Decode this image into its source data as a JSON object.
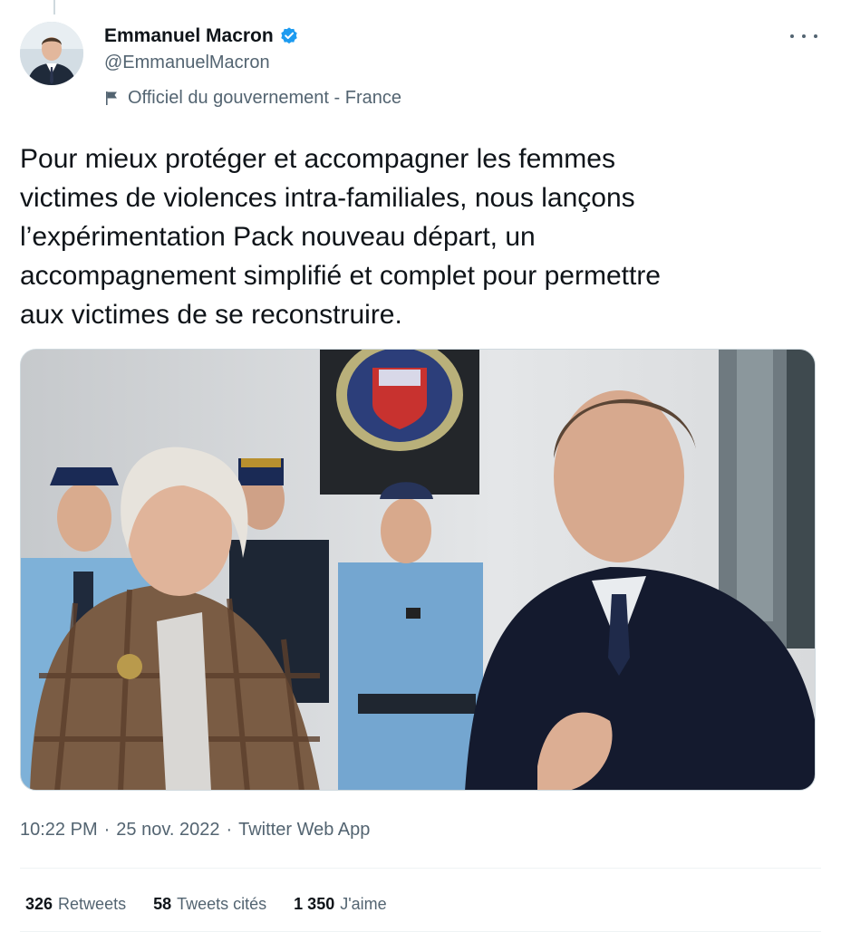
{
  "author": {
    "display_name": "Emmanuel Macron",
    "handle": "@EmmanuelMacron",
    "affiliation": "Officiel du gouvernement - France",
    "verified_color": "#1d9bf0"
  },
  "tweet": {
    "text": "Pour mieux protéger et accompagner les femmes\nvictimes de violences intra-familiales, nous lançons\nl’expérimentation Pack nouveau départ, un\naccompagnement simplifié et complet pour permettre\naux victimes de se reconstruire."
  },
  "meta": {
    "time": "10:22 PM",
    "separator": "·",
    "date": "25 nov. 2022",
    "source": "Twitter Web App"
  },
  "stats": {
    "retweets_count": "326",
    "retweets_label": "Retweets",
    "quotes_count": "58",
    "quotes_label": "Tweets cités",
    "likes_count": "1 350",
    "likes_label": "J'aime"
  },
  "icons": {
    "more": "more-horizontal-icon",
    "verified": "verified-badge-icon",
    "affiliation": "flag-icon"
  },
  "colors": {
    "text_primary": "#0f1419",
    "text_secondary": "#536471",
    "border": "#cfd9de",
    "accent": "#1d9bf0"
  }
}
